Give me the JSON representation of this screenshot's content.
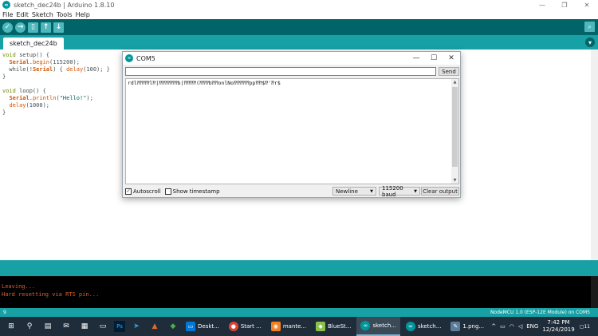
{
  "window": {
    "title": "sketch_dec24b | Arduino 1.8.10",
    "controls": [
      "—",
      "❐",
      "✕"
    ]
  },
  "menu": [
    "File",
    "Edit",
    "Sketch",
    "Tools",
    "Help"
  ],
  "toolbar": {
    "verify_icon": "✓",
    "upload_icon": "→",
    "new_icon": "▯",
    "open_icon": "↑",
    "save_icon": "↓",
    "serial_icon": "⌕"
  },
  "tab": {
    "name": "sketch_dec24b",
    "menu_icon": "▾"
  },
  "code": {
    "l1a": "void",
    "l1b": " setup() {",
    "l2a": "  ",
    "l2b": "Serial",
    "l2c": ".",
    "l2d": "begin",
    "l2e": "(115200);",
    "l3a": "  while(!",
    "l3b": "Serial",
    "l3c": ") { ",
    "l3d": "delay",
    "l3e": "(100); }",
    "l4": "}",
    "l6a": "void",
    "l6b": " loop() {",
    "l7a": "  ",
    "l7b": "Serial",
    "l7c": ".",
    "l7d": "println",
    "l7e": "(",
    "l7f": "\"Hello!\"",
    "l7g": ");",
    "l8a": "  ",
    "l8b": "delay",
    "l8c": "(1000);",
    "l9": "}"
  },
  "console": {
    "line1": "Leaving...",
    "line2": "Hard resetting via RTS pin..."
  },
  "status": {
    "line_number": "9",
    "board": "NodeMCU 1.0 (ESP-12E Module) on COM5"
  },
  "serial_monitor": {
    "title": "COM5",
    "controls": [
      "—",
      "☐",
      "✕"
    ],
    "input_value": "",
    "send_label": "Send",
    "output": "rdl⁇⁇⁇⁇l⁇|⁇⁇⁇⁇⁇⁇b|⁇⁇⁇⁇(⁇⁇⁇b⁇⁇onlNo⁇⁇⁇⁇⁇pp⁇⁇$⁇'⁇r$",
    "autoscroll_label": "Autoscroll",
    "autoscroll_checked": true,
    "timestamp_label": "Show timestamp",
    "timestamp_checked": false,
    "line_ending": "Newline",
    "baud": "115200 baud",
    "clear_label": "Clear output"
  },
  "taskbar": {
    "apps": [
      {
        "label": "Deskt...",
        "color": "#0078d7",
        "glyph": "▭"
      },
      {
        "label": "Start ...",
        "color": "#db4437",
        "glyph": "●"
      },
      {
        "label": "mante...",
        "color": "#f4811f",
        "glyph": "◉"
      },
      {
        "label": "BlueSt...",
        "color": "#8bc34a",
        "glyph": "◆"
      },
      {
        "label": "sketch...",
        "color": "#00979c",
        "glyph": "∞"
      },
      {
        "label": "sketch...",
        "color": "#00979c",
        "glyph": "∞"
      },
      {
        "label": "1.png...",
        "color": "#5c7c9a",
        "glyph": "✎"
      }
    ],
    "lang": "ENG",
    "time": "7:42 PM",
    "date": "12/24/2019",
    "notifications": "11"
  }
}
